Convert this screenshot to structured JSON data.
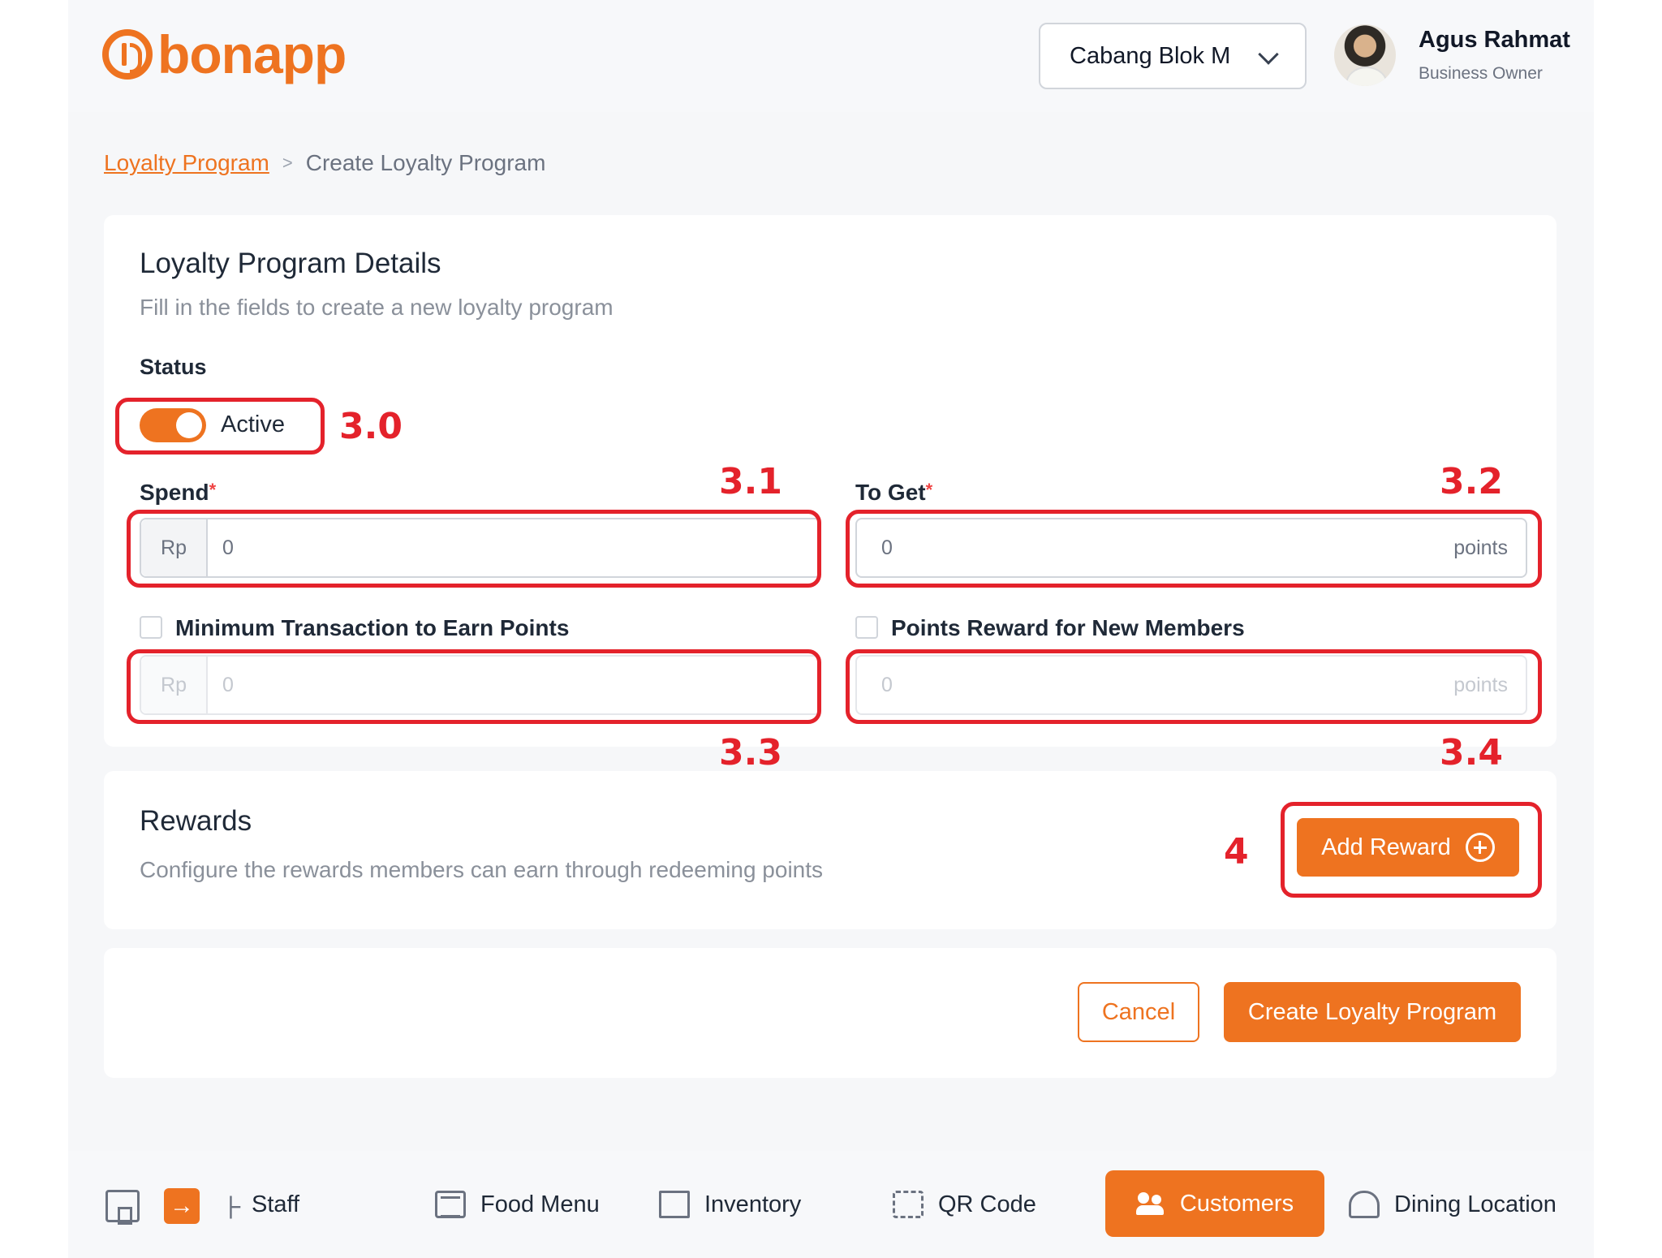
{
  "header": {
    "logo_text": "bonapp",
    "branch_selector": "Cabang Blok M",
    "user": {
      "name": "Agus Rahmat",
      "role": "Business Owner"
    }
  },
  "breadcrumb": {
    "parent": "Loyalty Program",
    "separator": ">",
    "current": "Create Loyalty Program"
  },
  "details": {
    "title": "Loyalty Program Details",
    "subtitle": "Fill in the fields to create a new loyalty program",
    "status_label": "Status",
    "status_value": "Active",
    "status_on": true,
    "spend": {
      "label": "Spend",
      "required_mark": "*",
      "prefix": "Rp",
      "value": "0"
    },
    "to_get": {
      "label": "To Get",
      "required_mark": "*",
      "value": "0",
      "suffix": "points"
    },
    "min_transaction": {
      "label": "Minimum Transaction to Earn Points",
      "checked": false,
      "prefix": "Rp",
      "value": "0"
    },
    "new_member_reward": {
      "label": "Points Reward for New Members",
      "checked": false,
      "value": "0",
      "suffix": "points"
    }
  },
  "rewards": {
    "title": "Rewards",
    "subtitle": "Configure the rewards members can earn through redeeming points",
    "add_button": "Add Reward"
  },
  "actions": {
    "cancel": "Cancel",
    "create": "Create Loyalty Program"
  },
  "annotations": [
    "3.0",
    "3.1",
    "3.2",
    "3.3",
    "3.4",
    "4"
  ],
  "bottom_nav": {
    "items": [
      "Staff",
      "Food Menu",
      "Inventory",
      "QR Code",
      "Customers",
      "Dining Location"
    ],
    "active": "Customers",
    "expand_glyph": "→"
  },
  "colors": {
    "accent": "#ee7320",
    "annotation": "#e4222b"
  }
}
